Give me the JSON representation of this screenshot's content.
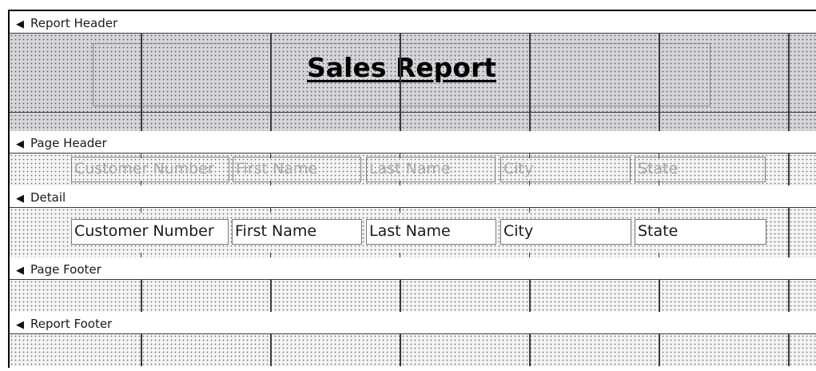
{
  "sections": {
    "report_header": "Report Header",
    "page_header": "Page Header",
    "detail": "Detail",
    "page_footer": "Page Footer",
    "report_footer": "Report Footer"
  },
  "report_title": "Sales Report",
  "page_header_labels": [
    "Customer Number",
    "First Name",
    "Last Name",
    "City",
    "State"
  ],
  "detail_fields": [
    "Customer Number",
    "First Name",
    "Last Name",
    "City",
    "State"
  ],
  "icons": {
    "collapse": "section-collapse-arrow-icon"
  },
  "colors": {
    "report_header_bg": "#d4d6da",
    "section_bg": "#f4f4f4",
    "grid_line": "#3a3a3a"
  }
}
